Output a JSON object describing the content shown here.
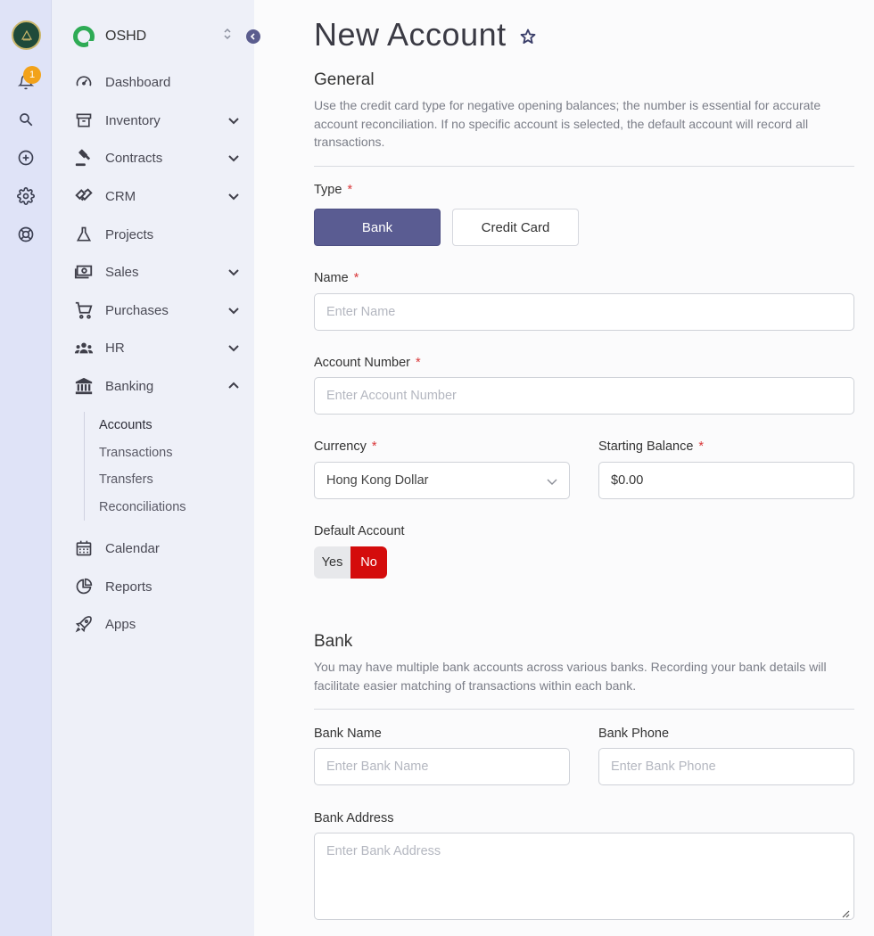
{
  "rail": {
    "notification_count": "1",
    "icons": [
      "bell-icon",
      "search-icon",
      "plus-circle-icon",
      "gear-icon",
      "lifebuoy-icon"
    ]
  },
  "sidebar": {
    "brand": "OSHD",
    "items": [
      {
        "label": "Dashboard",
        "icon": "gauge-icon",
        "expandable": false
      },
      {
        "label": "Inventory",
        "icon": "archive-icon",
        "expandable": true
      },
      {
        "label": "Contracts",
        "icon": "gavel-icon",
        "expandable": true
      },
      {
        "label": "CRM",
        "icon": "handshake-icon",
        "expandable": true
      },
      {
        "label": "Projects",
        "icon": "flask-icon",
        "expandable": false
      },
      {
        "label": "Sales",
        "icon": "money-icon",
        "expandable": true
      },
      {
        "label": "Purchases",
        "icon": "cart-icon",
        "expandable": true
      },
      {
        "label": "HR",
        "icon": "people-icon",
        "expandable": true
      },
      {
        "label": "Banking",
        "icon": "bank-icon",
        "expandable": true,
        "expanded": true
      },
      {
        "label": "Calendar",
        "icon": "calendar-icon",
        "expandable": false
      },
      {
        "label": "Reports",
        "icon": "pie-chart-icon",
        "expandable": false
      },
      {
        "label": "Apps",
        "icon": "rocket-icon",
        "expandable": false
      }
    ],
    "banking_sub": [
      "Accounts",
      "Transactions",
      "Transfers",
      "Reconciliations"
    ],
    "active_sub": "Accounts"
  },
  "main": {
    "title": "New Account",
    "general": {
      "title": "General",
      "description": "Use the credit card type for negative opening balances; the number is essential for accurate account reconciliation. If no specific account is selected, the default account will record all transactions."
    },
    "type": {
      "label": "Type",
      "options": [
        "Bank",
        "Credit Card"
      ],
      "selected": "Bank"
    },
    "name": {
      "label": "Name",
      "placeholder": "Enter Name",
      "value": ""
    },
    "account_number": {
      "label": "Account Number",
      "placeholder": "Enter Account Number",
      "value": ""
    },
    "currency": {
      "label": "Currency",
      "value": "Hong Kong Dollar"
    },
    "starting_balance": {
      "label": "Starting Balance",
      "value": "$0.00"
    },
    "default_account": {
      "label": "Default Account",
      "yes": "Yes",
      "no": "No",
      "selected": "No"
    },
    "bank": {
      "title": "Bank",
      "description": "You may have multiple bank accounts across various banks. Recording your bank details will facilitate easier matching of transactions within each bank.",
      "bank_name": {
        "label": "Bank Name",
        "placeholder": "Enter Bank Name"
      },
      "bank_phone": {
        "label": "Bank Phone",
        "placeholder": "Enter Bank Phone"
      },
      "bank_address": {
        "label": "Bank Address",
        "placeholder": "Enter Bank Address"
      }
    }
  },
  "colors": {
    "accent": "#5a5c92",
    "danger": "#d40c0c",
    "rail_bg": "#dfe3f7",
    "sidebar_bg": "#eef0f8",
    "badge": "#f2a21a"
  }
}
